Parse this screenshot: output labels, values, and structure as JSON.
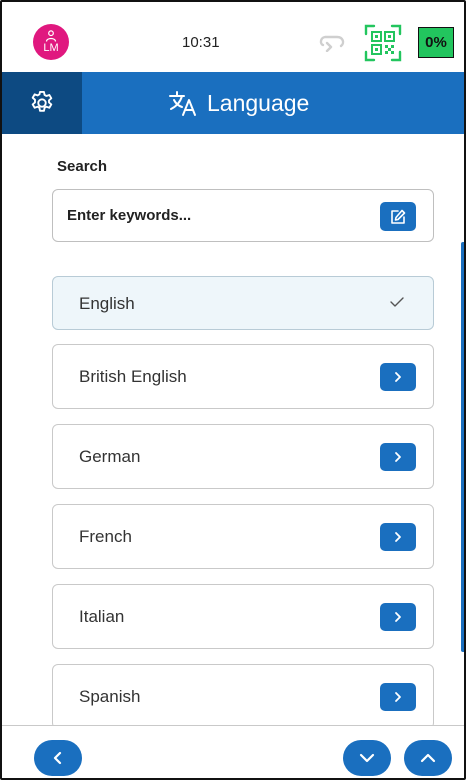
{
  "status_bar": {
    "avatar_initials": "LM",
    "time": "10:31",
    "battery": "0%",
    "battery_color": "#22c55e",
    "qr_icon_color": "#22c55e",
    "avatar_color": "#e0187f"
  },
  "header": {
    "title": "Language",
    "accent": "#1a6fbf",
    "settings_bg": "#0d4a82"
  },
  "search": {
    "label": "Search",
    "placeholder": "Enter keywords..."
  },
  "languages": [
    {
      "label": "English",
      "selected": true
    },
    {
      "label": "British English",
      "selected": false
    },
    {
      "label": "German",
      "selected": false
    },
    {
      "label": "French",
      "selected": false
    },
    {
      "label": "Italian",
      "selected": false
    },
    {
      "label": "Spanish",
      "selected": false
    }
  ],
  "icons": {
    "settings": "gear-icon",
    "translate": "translate-icon",
    "edit": "edit-icon",
    "back": "chevron-left-icon",
    "down": "chevron-down-icon",
    "up": "chevron-up-icon",
    "selected": "checkmark-icon",
    "go": "chevron-right-icon"
  }
}
